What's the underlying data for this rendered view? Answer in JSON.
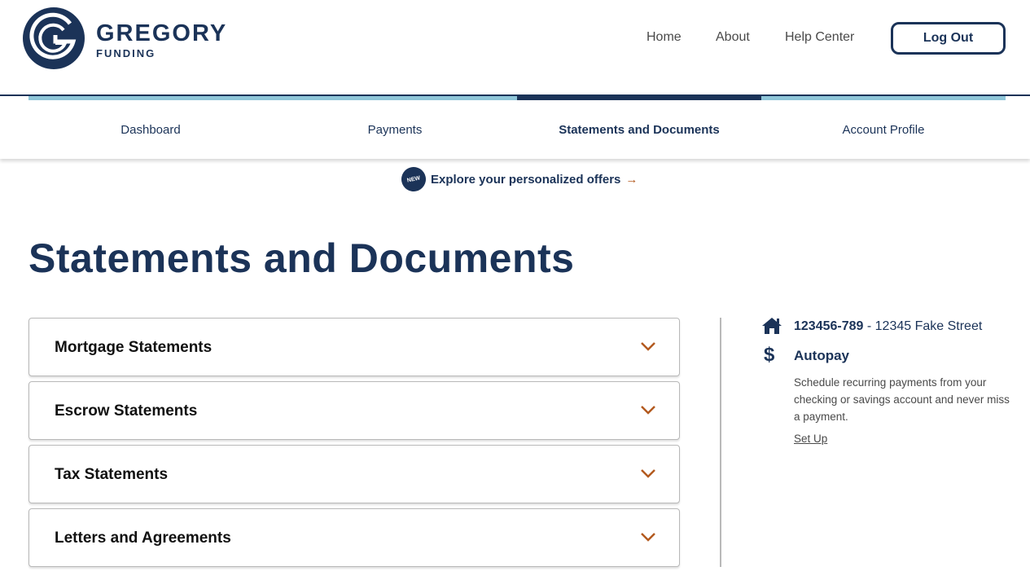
{
  "brand": {
    "name": "GREGORY",
    "sub": "FUNDING",
    "colors": {
      "navy": "#1b3358",
      "light_blue": "#8ec5d8",
      "accent_orange": "#b35a1f"
    }
  },
  "topnav": {
    "home": "Home",
    "about": "About",
    "help": "Help Center",
    "logout": "Log Out"
  },
  "tabs": [
    {
      "label": "Dashboard",
      "active": false
    },
    {
      "label": "Payments",
      "active": false
    },
    {
      "label": "Statements and Documents",
      "active": true
    },
    {
      "label": "Account Profile",
      "active": false
    }
  ],
  "offers": {
    "badge": "NEW",
    "text": "Explore your personalized offers",
    "arrow": "→"
  },
  "page_title": "Statements and Documents",
  "accordion": [
    {
      "label": "Mortgage Statements",
      "icon": "chevron-down-icon"
    },
    {
      "label": "Escrow Statements",
      "icon": "chevron-down-icon"
    },
    {
      "label": "Tax Statements",
      "icon": "chevron-down-icon"
    },
    {
      "label": "Letters and Agreements",
      "icon": "chevron-down-icon"
    }
  ],
  "sidebar": {
    "loan_number": "123456-789",
    "separator": " - ",
    "address": "12345 Fake Street",
    "dollar_symbol": "$",
    "autopay_title": "Autopay",
    "autopay_desc": "Schedule recurring payments from your checking or savings account and never miss a payment.",
    "setup_link": "Set Up"
  }
}
